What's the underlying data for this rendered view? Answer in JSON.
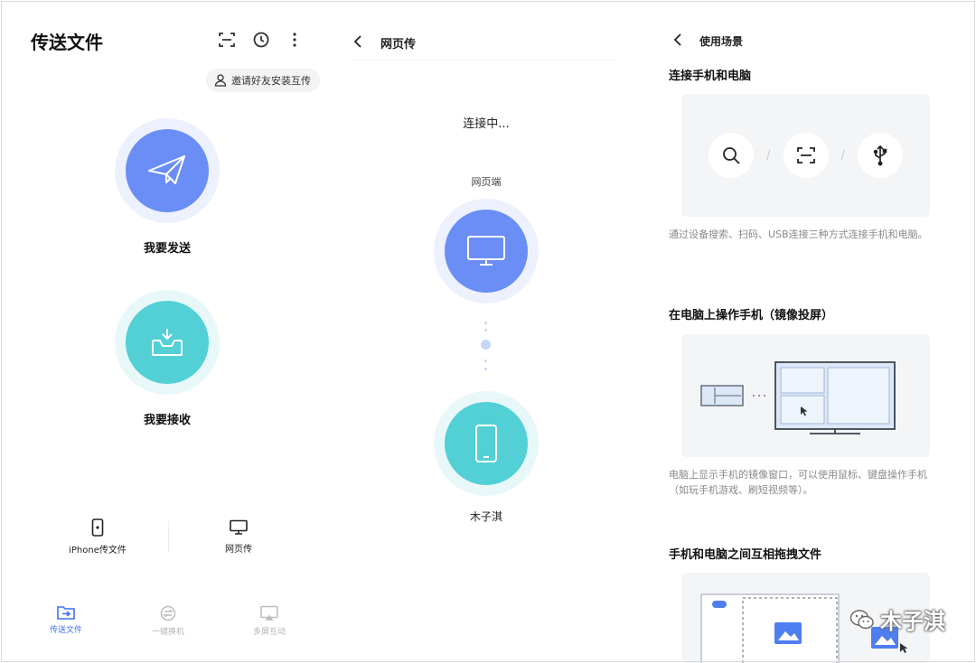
{
  "screen1": {
    "title": "传送文件",
    "invite_label": "邀请好友安装互传",
    "send_label": "我要发送",
    "receive_label": "我要接收",
    "cards": [
      {
        "label": "iPhone传文件",
        "icon": "phone-icon"
      },
      {
        "label": "网页传",
        "icon": "monitor-icon"
      }
    ],
    "nav": [
      {
        "label": "传送文件",
        "icon": "transfer-folder-icon",
        "active": true
      },
      {
        "label": "一键换机",
        "icon": "swap-icon",
        "active": false
      },
      {
        "label": "多屏互动",
        "icon": "cast-icon",
        "active": false
      }
    ]
  },
  "screen2": {
    "title": "网页传",
    "status": "连接中...",
    "web_label": "网页端",
    "device_label": "木子淇"
  },
  "screen3": {
    "title": "使用场景",
    "sections": [
      {
        "heading": "连接手机和电脑",
        "description": "通过设备搜索、扫码、USB连接三种方式连接手机和电脑。"
      },
      {
        "heading": "在电脑上操作手机（镜像投屏）",
        "description": "电脑上显示手机的镜像窗口，可以使用鼠标、键盘操作手机（如玩手机游戏、刷短视频等）。"
      },
      {
        "heading": "手机和电脑之间互相拖拽文件",
        "description": ""
      }
    ]
  },
  "watermark": "木子淇",
  "colors": {
    "accent_blue": "#6a8ef5",
    "accent_teal": "#52d0d6",
    "active_nav": "#3d6ff0"
  }
}
